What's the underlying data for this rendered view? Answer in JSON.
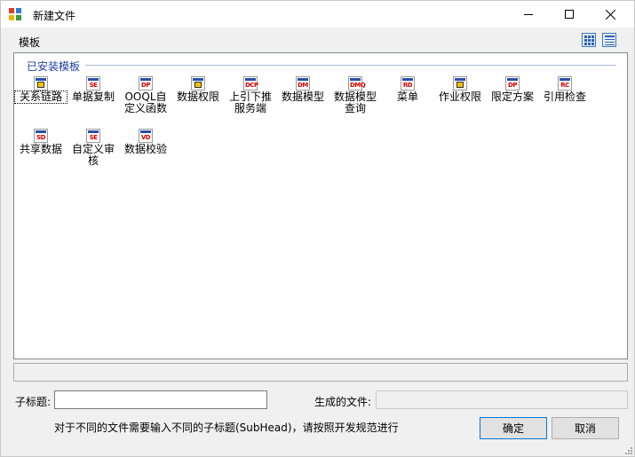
{
  "window": {
    "title": "新建文件"
  },
  "toolbar": {
    "template_label": "模板"
  },
  "group": {
    "header": "已安装模板"
  },
  "items": [
    {
      "code": "",
      "label": "关系链路",
      "icon": "relation-link-icon",
      "selected": true
    },
    {
      "code": "SE",
      "label": "单据复制",
      "icon": "bill-copy-icon"
    },
    {
      "code": "DP",
      "label": "OOQL自定义函数",
      "icon": "ooql-function-icon"
    },
    {
      "code": "",
      "label": "数据权限",
      "icon": "data-permission-icon"
    },
    {
      "code": "DCP",
      "label": "上引下推服务端",
      "icon": "push-pull-service-icon"
    },
    {
      "code": "DM",
      "label": "数据模型",
      "icon": "data-model-icon"
    },
    {
      "code": "DMQ",
      "label": "数据模型查询",
      "icon": "data-model-query-icon"
    },
    {
      "code": "RD",
      "label": "菜单",
      "icon": "menu-icon"
    },
    {
      "code": "",
      "label": "作业权限",
      "icon": "job-permission-icon"
    },
    {
      "code": "DP",
      "label": "限定方案",
      "icon": "restriction-scheme-icon"
    },
    {
      "code": "RC",
      "label": "引用检查",
      "icon": "reference-check-icon"
    },
    {
      "code": "SD",
      "label": "共享数据",
      "icon": "shared-data-icon"
    },
    {
      "code": "SE",
      "label": "自定义审核",
      "icon": "custom-audit-icon"
    },
    {
      "code": "VD",
      "label": "数据校验",
      "icon": "data-validation-icon"
    }
  ],
  "form": {
    "subtitle_label": "子标题:",
    "subtitle_value": "",
    "generated_label": "生成的文件:",
    "generated_value": "",
    "hint": "对于不同的文件需要输入不同的子标题(SubHead)，请按照开发规范进行"
  },
  "buttons": {
    "ok": "确定",
    "cancel": "取消"
  },
  "colors": {
    "group_header": "#1e3f9e",
    "icon_code": "#d40000",
    "icon_bar": "#2c4ea8",
    "window_bg": "#f0f0f0"
  }
}
